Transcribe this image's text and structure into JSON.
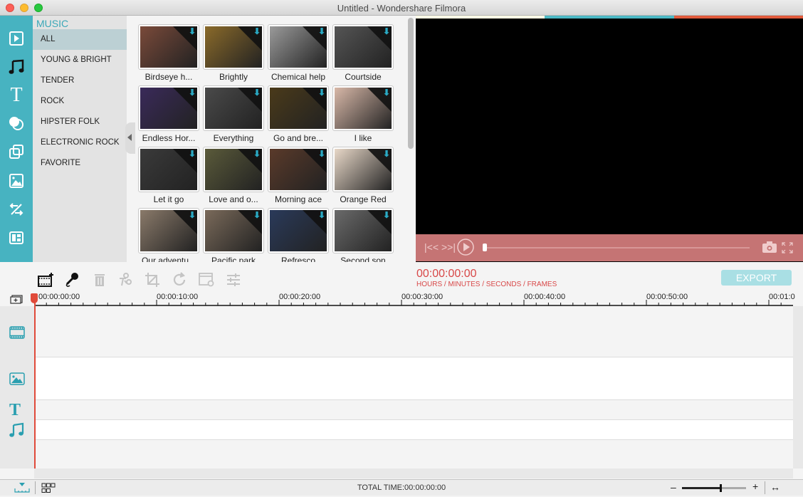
{
  "window": {
    "title": "Untitled - Wondershare Filmora"
  },
  "iconbar": {
    "items": [
      {
        "name": "media-icon",
        "active": false
      },
      {
        "name": "music-icon",
        "active": true
      },
      {
        "name": "text-icon",
        "active": false
      },
      {
        "name": "filters-icon",
        "active": false
      },
      {
        "name": "overlays-icon",
        "active": false
      },
      {
        "name": "elements-icon",
        "active": false
      },
      {
        "name": "transitions-icon",
        "active": false
      },
      {
        "name": "split-screen-icon",
        "active": false
      }
    ]
  },
  "categories": {
    "title": "MUSIC",
    "items": [
      "ALL",
      "YOUNG & BRIGHT",
      "TENDER",
      "ROCK",
      "HIPSTER FOLK",
      "ELECTRONIC ROCK",
      "FAVORITE"
    ],
    "selected": "ALL"
  },
  "library": {
    "tiles": [
      {
        "label": "Birdseye h...",
        "color": "#7a4a3a"
      },
      {
        "label": "Brightly",
        "color": "#8a6a2a"
      },
      {
        "label": "Chemical help",
        "color": "#9a9a9a"
      },
      {
        "label": "Courtside",
        "color": "#555555"
      },
      {
        "label": "Endless Hor...",
        "color": "#3a2a5a"
      },
      {
        "label": "Everything",
        "color": "#4a4a4a"
      },
      {
        "label": "Go and bre...",
        "color": "#4a3a1a"
      },
      {
        "label": "I like",
        "color": "#d8b8a8"
      },
      {
        "label": "Let it go",
        "color": "#3a3a3a"
      },
      {
        "label": "Love and o...",
        "color": "#5a5a3a"
      },
      {
        "label": "Morning ace",
        "color": "#5a3a2a"
      },
      {
        "label": "Orange Red",
        "color": "#e8d8c8"
      },
      {
        "label": "Our adventu...",
        "color": "#8a7a6a"
      },
      {
        "label": "Pacific park",
        "color": "#7a6a5a"
      },
      {
        "label": "Refresco",
        "color": "#2a3a5a"
      },
      {
        "label": "Second son",
        "color": "#6a6a6a"
      }
    ]
  },
  "preview": {
    "stripe_colors": [
      "#fdfbe6",
      "#4cb8c4",
      "#e05a3c"
    ],
    "accent": "#c57474",
    "progress": 0
  },
  "timecode": {
    "value": "00:00:00:00",
    "format": "HOURS / MINUTES / SECONDS / FRAMES"
  },
  "toolbar": {
    "export_label": "EXPORT"
  },
  "ruler": {
    "labels": [
      "00:00:00:00",
      "00:00:10:00",
      "00:00:20:00",
      "00:00:30:00",
      "00:00:40:00",
      "00:00:50:00",
      "00:01:0"
    ]
  },
  "status": {
    "total_time": "TOTAL TIME:00:00:00:00",
    "zoom_level": 0.6
  }
}
